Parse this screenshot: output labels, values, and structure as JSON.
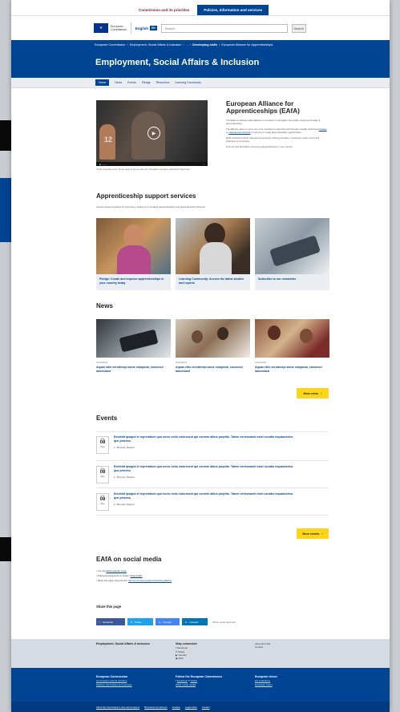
{
  "top_tabs": [
    "Commission and its priorities",
    "Policies, information and services"
  ],
  "header": {
    "logo_line1": "European",
    "logo_line2": "Commission",
    "language": "English",
    "language_code": "EN",
    "search_placeholder": "Search",
    "search_button": "Search"
  },
  "breadcrumb": [
    "European Commission",
    "Employment, Social Affairs & Inclusion",
    "...",
    "Developing skills",
    "European Alliance for Apprenticeships"
  ],
  "banner_title": "Employment, Social Affairs & Inclusion",
  "nav": [
    "Home",
    "News",
    "Events",
    "Pledge",
    "Resources",
    "Learning Community"
  ],
  "video": {
    "caption": "Youth unemployment: do we need to get on with our innovative company education? start here"
  },
  "eafa": {
    "title": "European Alliance for Apprenticeships (EAfA)",
    "p1": "The EAfA is a Europe-wide alliance on a mission to strengthen the quality, supply and image of apprenticeships.",
    "p2_a": "The Alliance relies on every one of its members to play their part through mutually reinforcing",
    "p2_link1": "pledges",
    "p2_b": "or",
    "p2_link2": "national commitments",
    "p2_c": "to improve or create apprenticeships opportunities.",
    "p3": "EAfA members include national governments, training providers, companies, trade unions and chambers of commerce.",
    "p4": "Find out how the EAfA is improving apprenticeships in your country."
  },
  "support": {
    "title": "Apprenticeship support services",
    "subtitle": "Access support services for improving, setting up or creating apprenticeships and apprenticeship schemes.",
    "cards": [
      {
        "label": "Pledge: Create and improve apprenticeships in your country today"
      },
      {
        "label": "Learning Community: Access the latest studies and reports"
      },
      {
        "label": "Subscribe to our newsletter"
      }
    ]
  },
  "news": {
    "title": "News",
    "items": [
      {
        "date": "21/10/2016",
        "title": "Aquas etiis veroderepi asme voluptum, consecut lamendant"
      },
      {
        "date": "21/10/2016",
        "title": "Aquas etiis veroderepi asme voluptum, consecut lamendant"
      },
      {
        "date": "21/10/2016",
        "title": "Aquas etiis veroderepi asme voluptum, consecut lamendant"
      }
    ],
    "more_label": "More news"
  },
  "events": {
    "title": "Events",
    "items": [
      {
        "month": "Tue",
        "day": "08",
        "year": "Sep",
        "title": "Ecidebit ipsapid et reprendium quo norro ectio volorescid qui cornete alitus porpitio. Tatem verteusandi estel occatio mquasserius que petcess.",
        "location": "Brussels, Belgium"
      },
      {
        "month": "Tue",
        "day": "08",
        "year": "Sep",
        "title": "Ecidebit ipsapid et reprendium quo norro ectio volorescid qui cornete alitus porpitio. Tatem verteusandi estel occatio mquasserius que petcess.",
        "location": "Brussels, Belgium"
      },
      {
        "month": "Tue",
        "day": "08",
        "year": "Sep",
        "title": "Ecidebit ipsapid et reprendium quo norro ectio volorescid qui cornete alitus porpitio. Tatem verteusandi estel occatio mquasserius que petcess.",
        "location": "Brussels, Belgium"
      }
    ],
    "more_label": "More events"
  },
  "social": {
    "title": "EAfA on social media",
    "line1_text": "Join the",
    "line1_link": "EAfA LinkedIn group",
    "line2_text": "Follow developments on Twitter:",
    "line2_link": "#ApprentEU",
    "line3_text": "Share this page using the link:",
    "line3_link": "http://ec.europa.eu/apprenticeships-alliance"
  },
  "share": {
    "title": "Share this page",
    "buttons": [
      "Facebook",
      "Twitter",
      "Google+",
      "LinkedIn"
    ],
    "more": "Other social networks"
  },
  "footer1": {
    "col1": "Employment, Social Affairs & Inclusion",
    "col2_title": "Stay connected",
    "col2_items": [
      "Facebook",
      "Twitter",
      "Youtube",
      "RSS"
    ],
    "col3_items": [
      "About this Site",
      "Contact"
    ]
  },
  "footer2": {
    "col1_title": "European Commission",
    "col1_items": [
      "Commission and its priorities",
      "Policies, information and services"
    ],
    "col2_title": "Follow the European Commission",
    "col2_items": [
      "Facebook",
      "Twitter",
      "Other social media"
    ],
    "col3_title": "European Union",
    "col3_items": [
      "EU institutions",
      "European Union"
    ]
  },
  "footer3": [
    "About the Commission's new web presence",
    "Resources for partners",
    "Cookies",
    "Legal notice",
    "Contact"
  ],
  "colors": {
    "brand": "#004494",
    "accent": "#ffd617"
  }
}
